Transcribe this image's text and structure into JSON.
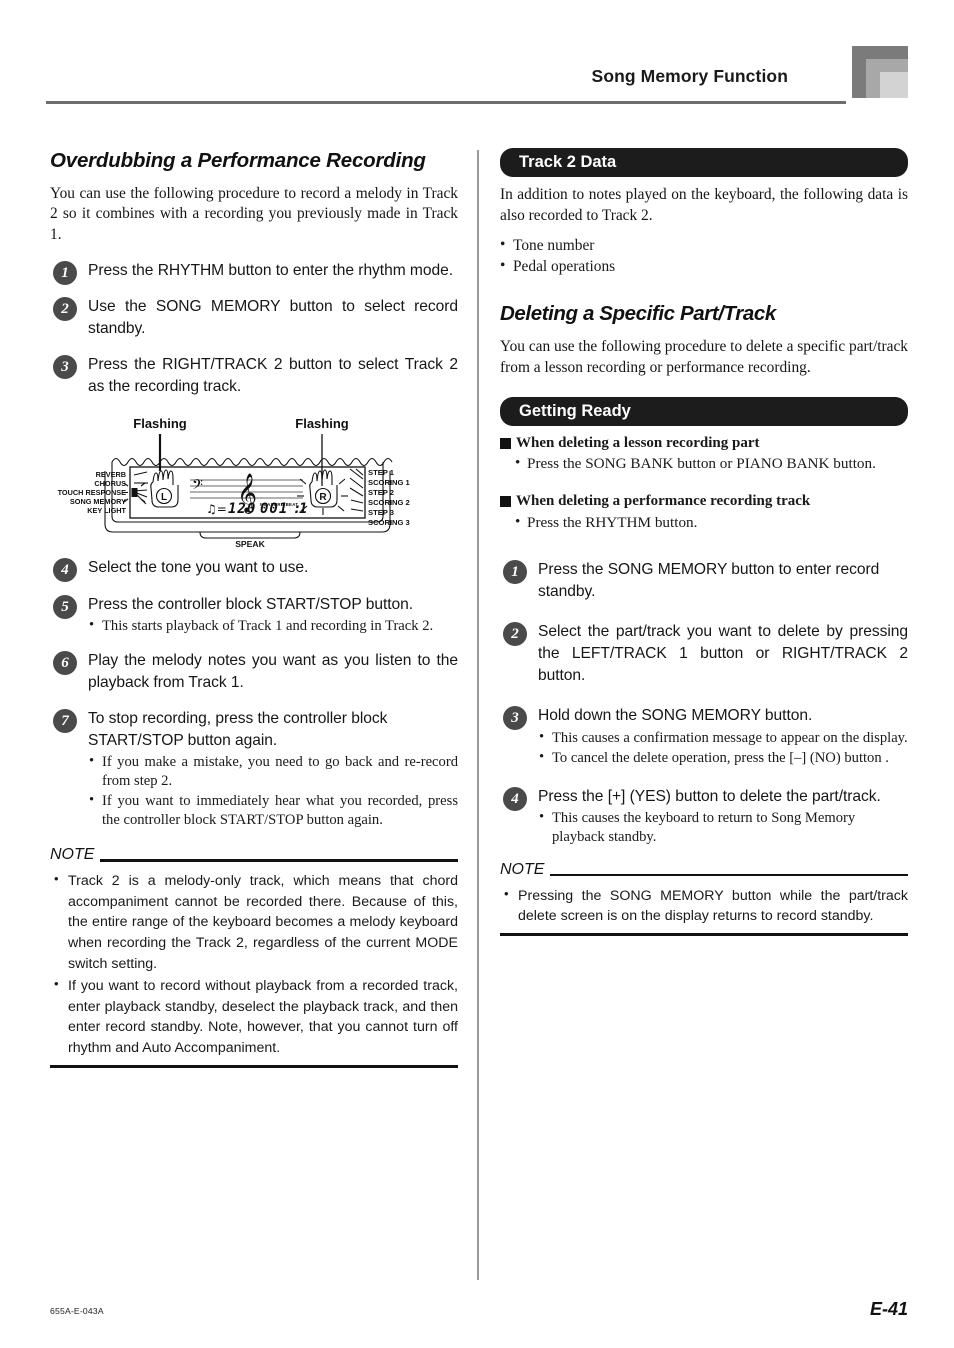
{
  "header": {
    "title": "Song Memory Function",
    "corner_icon": "corner-block-decoration"
  },
  "footer": {
    "doc_code": "655A-E-043A",
    "page_number": "E-41"
  },
  "left_column": {
    "section_title": "Overdubbing a Performance Recording",
    "intro": "You can use the following procedure to record a melody in Track 2 so it combines with a recording you previously made in Track 1.",
    "steps": [
      {
        "number": "1",
        "text": "Press the RHYTHM button to enter the rhythm mode.",
        "bullets": []
      },
      {
        "number": "2",
        "text": "Use the SONG MEMORY button to select record standby.",
        "bullets": []
      },
      {
        "number": "3",
        "text": "Press the RIGHT/TRACK 2 button to select Track 2 as the recording track.",
        "bullets": []
      },
      {
        "number": "4",
        "text": "Select the tone you want to use.",
        "bullets": []
      },
      {
        "number": "5",
        "text": "Press the controller block START/STOP button.",
        "bullets": [
          "This starts playback of Track 1 and recording in Track 2."
        ]
      },
      {
        "number": "6",
        "text": "Play the melody notes you want as you listen to the playback from Track 1.",
        "bullets": []
      },
      {
        "number": "7",
        "text": "To stop recording, press the controller block START/STOP button again.",
        "bullets": [
          "If you make a mistake, you need to go back and re-record from step 2.",
          "If you want to immediately hear what you recorded, press the controller block START/STOP button again."
        ]
      }
    ],
    "figure": {
      "flashing_label_left": "Flashing",
      "flashing_label_right": "Flashing",
      "left_indicators": [
        "REVERB",
        "CHORUS",
        "TOUCH RESPONSE",
        "SONG MEMORY",
        "KEY LIGHT"
      ],
      "right_indicators": [
        "STEP 1",
        "SCORING 1",
        "STEP 2",
        "SCORING 2",
        "STEP 3",
        "SCORING 3"
      ],
      "hand_left": "L",
      "hand_right": "R",
      "tempo_value": "120",
      "measure_beat_label": "MEASURE BEAT",
      "measure_value": "001",
      "beat_value": "1",
      "speak_label": "SPEAK"
    },
    "note": {
      "label": "NOTE",
      "items": [
        "Track 2 is a melody-only track, which means that chord accompaniment cannot be recorded there. Because of this, the entire range of the keyboard becomes a melody keyboard when recording the Track 2, regardless of the current MODE switch setting.",
        "If you want to record without playback from a recorded track, enter playback standby, deselect the playback track, and then enter record standby. Note, however, that you cannot turn off rhythm and Auto Accompaniment."
      ]
    }
  },
  "right_column": {
    "track2_pill": "Track 2 Data",
    "track2_intro": "In addition to notes played on the keyboard, the following data is also recorded to Track 2.",
    "track2_items": [
      "Tone number",
      "Pedal operations"
    ],
    "delete_section_title": "Deleting a Specific Part/Track",
    "delete_intro": "You can use the following procedure to delete a specific part/track from a lesson recording or performance recording.",
    "getting_ready_pill": "Getting Ready",
    "ready_blocks": [
      {
        "heading": "When deleting a lesson recording part",
        "bullet": "Press the SONG BANK button or PIANO BANK button."
      },
      {
        "heading": "When deleting a performance recording track",
        "bullet": "Press the RHYTHM button."
      }
    ],
    "steps": [
      {
        "number": "1",
        "text": "Press the SONG MEMORY button to enter record standby.",
        "bullets": []
      },
      {
        "number": "2",
        "text": "Select the part/track you want to delete by pressing the LEFT/TRACK 1 button or RIGHT/TRACK 2 button.",
        "bullets": []
      },
      {
        "number": "3",
        "text": "Hold down the SONG MEMORY button.",
        "bullets": [
          "This causes a confirmation message to appear on the display.",
          "To cancel the delete operation, press the [–] (NO) button ."
        ]
      },
      {
        "number": "4",
        "text": "Press the [+] (YES) button to delete the part/track.",
        "bullets": [
          "This causes the keyboard to return to Song Memory playback standby."
        ]
      }
    ],
    "note": {
      "label": "NOTE",
      "items": [
        "Pressing the SONG MEMORY button while the part/track delete screen is on the display returns to record standby."
      ]
    }
  }
}
